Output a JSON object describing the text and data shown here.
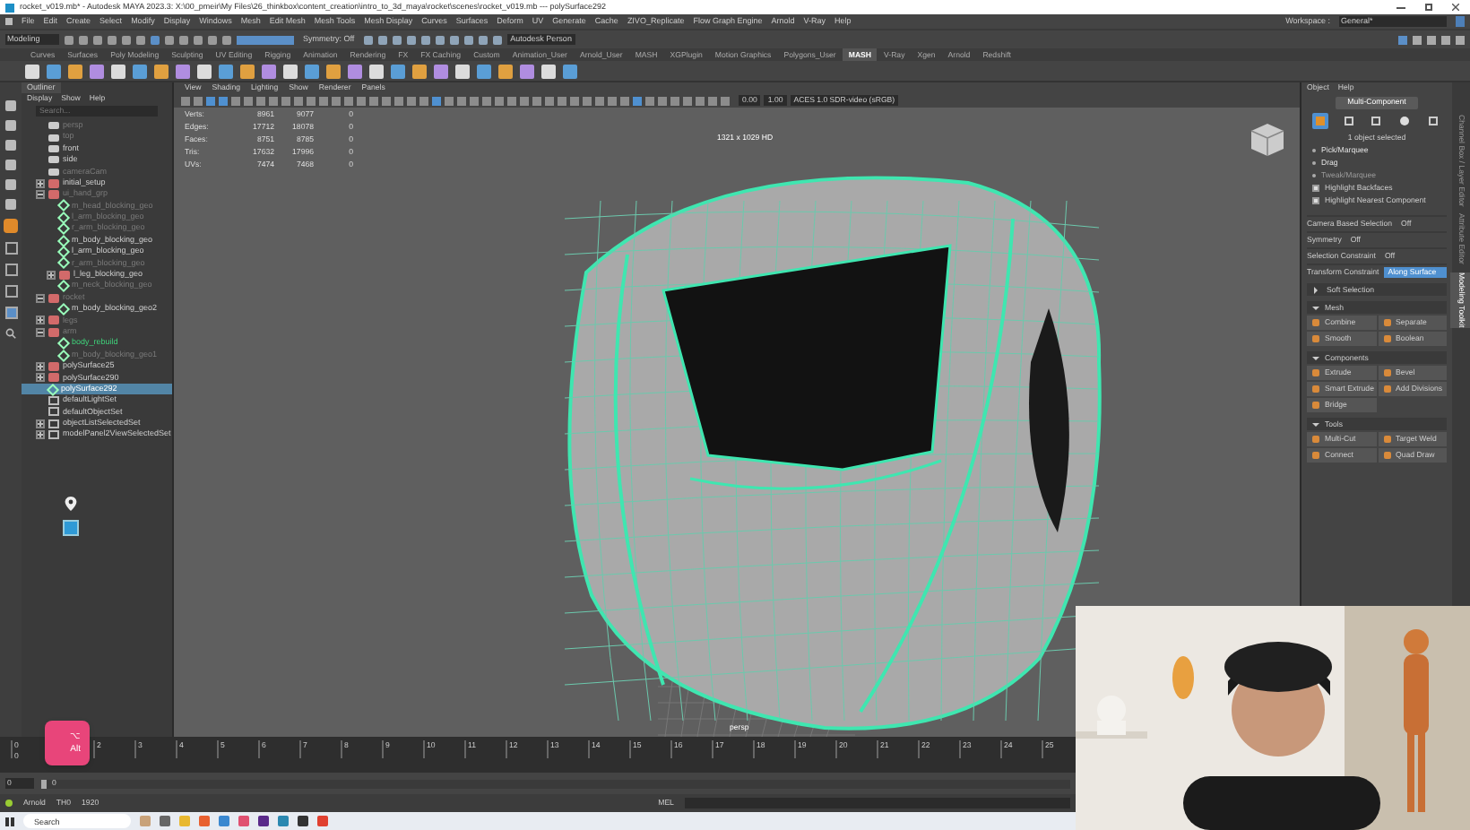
{
  "window": {
    "title": "rocket_v019.mb* - Autodesk MAYA 2023.3: X:\\00_pmeir\\My Files\\26_thinkbox\\content_creation\\intro_to_3d_maya\\rocket\\scenes\\rocket_v019.mb  ---  polySurface292"
  },
  "menu_bar": [
    "File",
    "Edit",
    "Create",
    "Select",
    "Modify",
    "Display",
    "Windows",
    "Mesh",
    "Edit Mesh",
    "Mesh Tools",
    "Mesh Display",
    "Curves",
    "Surfaces",
    "Deform",
    "UV",
    "Generate",
    "Cache",
    "ZIVO_Replicate",
    "Flow Graph Engine",
    "Arnold",
    "V-Ray",
    "Help"
  ],
  "workspace": {
    "label": "Workspace :",
    "value": "General*"
  },
  "status_line": {
    "menu_set": "Modeling",
    "symmetry": "Symmetry: Off",
    "account": "Autodesk Person"
  },
  "shelf_tabs": [
    {
      "label": "Curves",
      "selected": false
    },
    {
      "label": "Surfaces",
      "selected": false
    },
    {
      "label": "Poly Modeling",
      "selected": false
    },
    {
      "label": "Sculpting",
      "selected": false
    },
    {
      "label": "UV Editing",
      "selected": false
    },
    {
      "label": "Rigging",
      "selected": false
    },
    {
      "label": "Animation",
      "selected": false
    },
    {
      "label": "Rendering",
      "selected": false
    },
    {
      "label": "FX",
      "selected": false
    },
    {
      "label": "FX Caching",
      "selected": false
    },
    {
      "label": "Custom",
      "selected": false
    },
    {
      "label": "Animation_User",
      "selected": false
    },
    {
      "label": "Arnold_User",
      "selected": false
    },
    {
      "label": "MASH",
      "selected": false
    },
    {
      "label": "XGPlugin",
      "selected": false
    },
    {
      "label": "Motion Graphics",
      "selected": false
    },
    {
      "label": "Polygons_User",
      "selected": false
    },
    {
      "label": "MASH",
      "selected": true
    },
    {
      "label": "V-Ray",
      "selected": false
    },
    {
      "label": "Xgen",
      "selected": false
    },
    {
      "label": "Arnold",
      "selected": false
    },
    {
      "label": "Redshift",
      "selected": false
    }
  ],
  "outliner": {
    "title": "Outliner",
    "menu": [
      "Display",
      "Show",
      "Help"
    ],
    "search": {
      "placeholder": "Search..."
    },
    "items": [
      {
        "label": "persp",
        "kind": "camera",
        "hidden": true,
        "selected": false
      },
      {
        "label": "top",
        "kind": "camera",
        "hidden": true,
        "selected": false
      },
      {
        "label": "front",
        "kind": "camera",
        "hidden": false,
        "selected": false
      },
      {
        "label": "side",
        "kind": "camera",
        "hidden": false,
        "selected": false
      },
      {
        "label": "cameraCam",
        "kind": "camera",
        "hidden": true,
        "selected": false
      },
      {
        "label": "initial_setup",
        "kind": "group",
        "hidden": false,
        "selected": false,
        "expanded": false
      },
      {
        "label": "ui_hand_grp",
        "kind": "group",
        "hidden": true,
        "selected": false,
        "expanded": true,
        "children": [
          {
            "label": "m_head_blocking_geo",
            "kind": "mesh",
            "hidden": true,
            "selected": false
          },
          {
            "label": "l_arm_blocking_geo",
            "kind": "mesh",
            "hidden": true,
            "selected": false
          },
          {
            "label": "r_arm_blocking_geo",
            "kind": "mesh",
            "hidden": true,
            "selected": false
          },
          {
            "label": "m_body_blocking_geo",
            "kind": "mesh",
            "hidden": false,
            "selected": false
          },
          {
            "label": "l_arm_blocking_geo",
            "kind": "mesh",
            "hidden": false,
            "selected": false
          },
          {
            "label": "r_arm_blocking_geo",
            "kind": "mesh",
            "hidden": true,
            "selected": false
          },
          {
            "label": "l_leg_blocking_geo",
            "kind": "group",
            "hidden": false,
            "selected": false,
            "expanded": false
          },
          {
            "label": "m_neck_blocking_geo",
            "kind": "mesh",
            "hidden": true,
            "selected": false
          }
        ]
      },
      {
        "label": "rocket",
        "kind": "group",
        "hidden": true,
        "selected": false,
        "expanded": true,
        "children": [
          {
            "label": "m_body_blocking_geo2",
            "kind": "mesh",
            "hidden": false,
            "selected": false
          }
        ]
      },
      {
        "label": "legs",
        "kind": "group",
        "hidden": true,
        "selected": false,
        "expanded": false
      },
      {
        "label": "arm",
        "kind": "group",
        "hidden": true,
        "selected": false,
        "expanded": true,
        "children": [
          {
            "label": "body_rebuild",
            "kind": "mesh",
            "hidden": false,
            "active": true,
            "selected": false
          },
          {
            "label": "m_body_blocking_geo1",
            "kind": "mesh",
            "hidden": true,
            "selected": false
          }
        ]
      },
      {
        "label": "polySurface25",
        "kind": "group",
        "hidden": false,
        "selected": false,
        "expanded": false
      },
      {
        "label": "polySurface290",
        "kind": "group",
        "hidden": false,
        "selected": false,
        "expanded": false
      },
      {
        "label": "polySurface292",
        "kind": "mesh",
        "hidden": false,
        "selected": true
      },
      {
        "label": "defaultLightSet",
        "kind": "set",
        "hidden": false,
        "selected": false
      },
      {
        "label": "defaultObjectSet",
        "kind": "set",
        "hidden": false,
        "selected": false
      },
      {
        "label": "objectListSelectedSet",
        "kind": "set",
        "hidden": false,
        "selected": false,
        "expanded": false
      },
      {
        "label": "modelPanel2ViewSelectedSet",
        "kind": "set",
        "hidden": false,
        "selected": false,
        "expanded": false
      }
    ]
  },
  "viewport": {
    "menu": [
      "View",
      "Shading",
      "Lighting",
      "Show",
      "Renderer",
      "Panels"
    ],
    "exposure": "0.00",
    "gamma": "1.00",
    "color_space": "ACES 1.0 SDR-video (sRGB)",
    "stats": [
      {
        "label": "Verts:",
        "values": [
          "8961",
          "9077",
          "0"
        ]
      },
      {
        "label": "Edges:",
        "values": [
          "17712",
          "18078",
          "0"
        ]
      },
      {
        "label": "Faces:",
        "values": [
          "8751",
          "8785",
          "0"
        ]
      },
      {
        "label": "Tris:",
        "values": [
          "17632",
          "17996",
          "0"
        ]
      },
      {
        "label": "UVs:",
        "values": [
          "7474",
          "7468",
          "0"
        ]
      }
    ],
    "resolution": "1321 x 1029 HD",
    "camera": "persp"
  },
  "toolkit": {
    "menu": [
      "Object",
      "Help"
    ],
    "mode_button": "Multi-Component",
    "modes": [
      {
        "selected": true
      },
      {
        "selected": false
      },
      {
        "selected": false
      },
      {
        "selected": false
      },
      {
        "selected": false
      }
    ],
    "status": "1 object selected",
    "options": [
      {
        "kind": "plain",
        "label": "Pick/Marquee"
      },
      {
        "kind": "plain",
        "label": "Drag"
      },
      {
        "kind": "plain",
        "label": "Tweak/Marquee",
        "disabled": true
      },
      {
        "kind": "check",
        "label": "Highlight Backfaces",
        "checked": true
      },
      {
        "kind": "check",
        "label": "Highlight Nearest Component",
        "checked": true
      }
    ],
    "settings": [
      {
        "label": "Camera Based Selection",
        "value": "Off"
      },
      {
        "label": "Symmetry",
        "value": "Off"
      },
      {
        "label": "Selection Constraint",
        "value": "Off"
      },
      {
        "label": "Transform Constraint",
        "value": "Along Surface",
        "highlighted": true
      }
    ],
    "sections": [
      {
        "title": "Soft Selection",
        "expanded": false
      },
      {
        "title": "Mesh",
        "expanded": true,
        "tools": [
          "Combine",
          "Separate",
          "Smooth",
          "Boolean"
        ]
      },
      {
        "title": "Components",
        "expanded": true,
        "tools": [
          "Extrude",
          "Bevel",
          "Smart Extrude",
          "Add Divisions",
          "Bridge"
        ]
      },
      {
        "title": "Tools",
        "expanded": true,
        "tools": [
          "Multi-Cut",
          "Target Weld",
          "Connect",
          "Quad Draw"
        ]
      }
    ],
    "side_tabs": [
      {
        "label": "Channel Box / Layer Editor",
        "selected": false
      },
      {
        "label": "Attribute Editor",
        "selected": false
      },
      {
        "label": "Modeling Toolkit",
        "selected": true
      }
    ]
  },
  "keystroke": {
    "symbol": "⌥",
    "label": "Alt"
  },
  "timeline": {
    "ticks": [
      "0",
      "2",
      "3",
      "4",
      "5",
      "6",
      "7",
      "8",
      "9",
      "10",
      "11",
      "12",
      "13",
      "14",
      "15",
      "16",
      "17",
      "18",
      "19",
      "20",
      "21",
      "22",
      "23",
      "24",
      "25"
    ],
    "current": "0"
  },
  "range": {
    "start": "0",
    "inner_start": "0",
    "level": 0
  },
  "command_line": {
    "items": [
      "Arnold",
      "TH0",
      "1920"
    ],
    "language": "MEL"
  },
  "taskbar": {
    "search": {
      "placeholder": "Search"
    }
  }
}
